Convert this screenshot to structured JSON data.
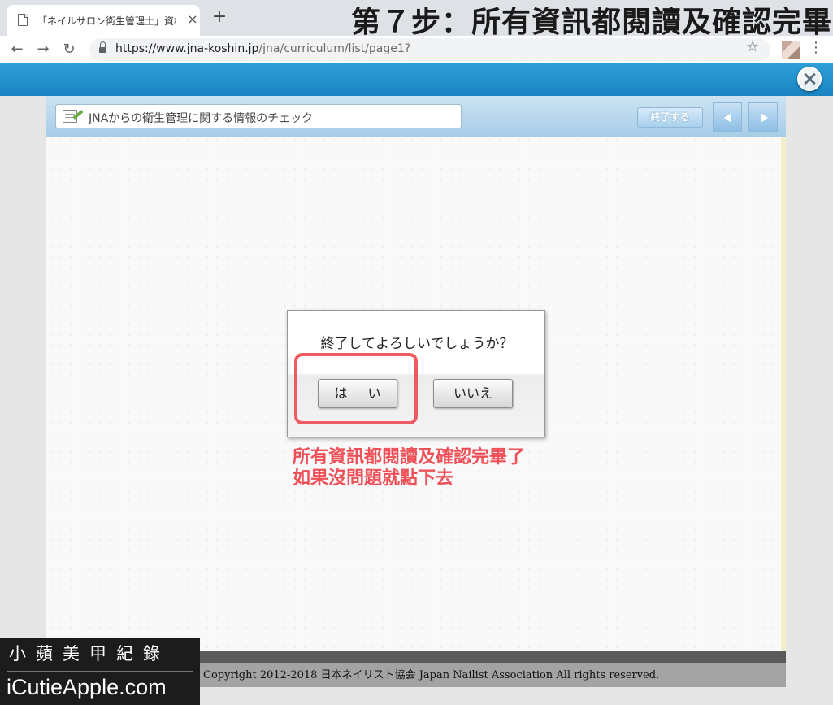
{
  "browser": {
    "tab_title": "「ネイルサロン衛生管理士」資格",
    "tab_close": "×",
    "new_tab": "+",
    "url_host": "https://www.jna-koshin.jp",
    "url_path": "/jna/curriculum/list/page1?",
    "icons": [
      "page-icon",
      "back-arrow-icon",
      "forward-arrow-icon",
      "reload-icon",
      "lock-icon",
      "star-icon",
      "kebab-menu-icon"
    ]
  },
  "overlay": {
    "step_title": "第７步：所有資訊都閱讀及確認完畢"
  },
  "site": {
    "header_color": "#2396d0"
  },
  "content": {
    "title": "JNAからの衛生管理に関する情報のチェック",
    "end_button": "終了する"
  },
  "dialog": {
    "question": "終了してよろしいでしょうか？",
    "yes": "は い",
    "no": "いいえ"
  },
  "annotation": {
    "line1": "所有資訊都閱讀及確認完畢了",
    "line2": "如果沒問題就點下去",
    "color": "#ef5058"
  },
  "footer": {
    "copyright": "Copyright 2012-2018 日本ネイリスト協会 Japan Nailist Association All rights reserved."
  },
  "watermark": {
    "chinese": "小蘋美甲紀錄",
    "english": "iCutieApple.com"
  }
}
